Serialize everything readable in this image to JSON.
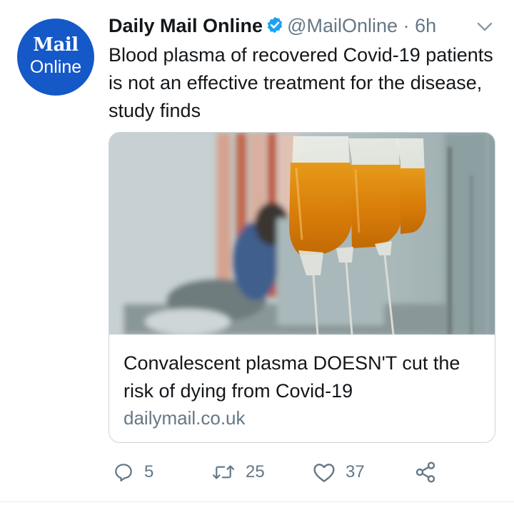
{
  "author": {
    "avatar_brand": "Mail",
    "avatar_sub": "Online",
    "display_name": "Daily Mail Online",
    "handle": "@MailOnline",
    "separator": "·",
    "time": "6h"
  },
  "tweet": {
    "text": "Blood plasma of recovered Covid-19 patients is not an effective treatment for the disease, study finds"
  },
  "card": {
    "title": "Convalescent plasma DOESN'T cut the risk of dying from Covid-19",
    "domain": "dailymail.co.uk"
  },
  "actions": {
    "reply_count": "5",
    "retweet_count": "25",
    "like_count": "37"
  },
  "colors": {
    "avatar_bg": "#1558c8",
    "verified": "#1da1f2",
    "muted_text": "#657786",
    "plasma": "#e08a10"
  },
  "icons": [
    "verified-badge-icon",
    "caret-down-icon",
    "reply-icon",
    "retweet-icon",
    "like-icon",
    "share-icon"
  ]
}
